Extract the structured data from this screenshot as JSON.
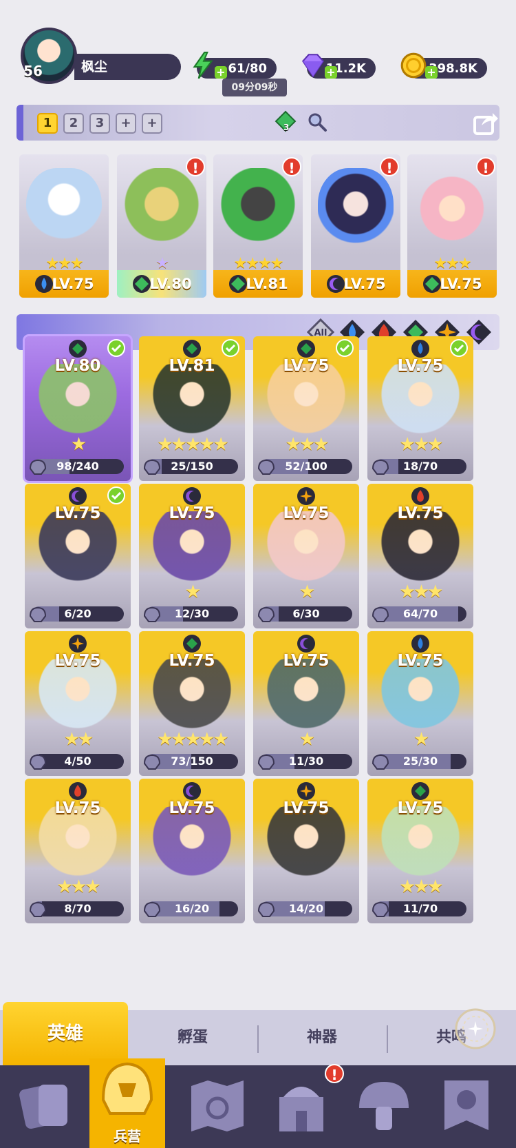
{
  "player": {
    "level": "56",
    "name": "枫尘"
  },
  "resources": {
    "energy": "61/80",
    "energy_timer": "09分09秒",
    "gems": "11.2K",
    "coins": "398.8K"
  },
  "team_tabs": [
    "1",
    "2",
    "3",
    "+",
    "+"
  ],
  "team_gem_badge": "3",
  "team": [
    {
      "level": "LV.75",
      "stars": "★★★",
      "element": "water"
    },
    {
      "level": "LV.80",
      "stars": "★",
      "element": "wind"
    },
    {
      "level": "LV.81",
      "stars": "★★★★",
      "element": "wind"
    },
    {
      "level": "LV.75",
      "stars": "",
      "element": "dark"
    },
    {
      "level": "LV.75",
      "stars": "★★★",
      "element": "wind"
    }
  ],
  "filter": {
    "all_label": "All"
  },
  "heroes": [
    {
      "level": "LV.80",
      "progress": "98/240",
      "fraction": 0.41,
      "stars": "★",
      "element": "wind",
      "checked": true,
      "theme": "purple"
    },
    {
      "level": "LV.81",
      "progress": "25/150",
      "fraction": 0.17,
      "stars": "★★★★★",
      "element": "wind",
      "checked": true,
      "theme": "gold"
    },
    {
      "level": "LV.75",
      "progress": "52/100",
      "fraction": 0.52,
      "stars": "★★★",
      "element": "wind",
      "checked": true,
      "theme": "gold"
    },
    {
      "level": "LV.75",
      "progress": "18/70",
      "fraction": 0.26,
      "stars": "★★★",
      "element": "water",
      "checked": true,
      "theme": "gold"
    },
    {
      "level": "LV.75",
      "progress": "6/20",
      "fraction": 0.3,
      "stars": "",
      "element": "dark",
      "checked": true,
      "theme": "gold"
    },
    {
      "level": "LV.75",
      "progress": "12/30",
      "fraction": 0.4,
      "stars": "★",
      "element": "dark",
      "checked": false,
      "theme": "gold"
    },
    {
      "level": "LV.75",
      "progress": "6/30",
      "fraction": 0.2,
      "stars": "★",
      "element": "light",
      "checked": false,
      "theme": "gold"
    },
    {
      "level": "LV.75",
      "progress": "64/70",
      "fraction": 0.91,
      "stars": "★★★",
      "element": "fire",
      "checked": false,
      "theme": "gold"
    },
    {
      "level": "LV.75",
      "progress": "4/50",
      "fraction": 0.08,
      "stars": "★★",
      "element": "light",
      "checked": false,
      "theme": "gold"
    },
    {
      "level": "LV.75",
      "progress": "73/150",
      "fraction": 0.49,
      "stars": "★★★★★",
      "element": "wind",
      "checked": false,
      "theme": "gold"
    },
    {
      "level": "LV.75",
      "progress": "11/30",
      "fraction": 0.37,
      "stars": "★",
      "element": "dark",
      "checked": false,
      "theme": "gold"
    },
    {
      "level": "LV.75",
      "progress": "25/30",
      "fraction": 0.83,
      "stars": "★",
      "element": "water",
      "checked": false,
      "theme": "gold"
    },
    {
      "level": "LV.75",
      "progress": "8/70",
      "fraction": 0.11,
      "stars": "★★★",
      "element": "fire",
      "checked": false,
      "theme": "gold"
    },
    {
      "level": "LV.75",
      "progress": "16/20",
      "fraction": 0.8,
      "stars": "",
      "element": "dark",
      "checked": false,
      "theme": "gold"
    },
    {
      "level": "LV.75",
      "progress": "14/20",
      "fraction": 0.7,
      "stars": "",
      "element": "light",
      "checked": false,
      "theme": "gold"
    },
    {
      "level": "LV.75",
      "progress": "11/70",
      "fraction": 0.16,
      "stars": "★★★",
      "element": "wind",
      "checked": false,
      "theme": "gold"
    }
  ],
  "subtabs": [
    "英雄",
    "孵蛋",
    "神器",
    "共鸣"
  ],
  "nav": {
    "barracks_label": "兵营"
  },
  "colors": {
    "water": "#2e7fe0",
    "fire": "#e0412b",
    "wind": "#2aa24a",
    "light": "#f2a20f",
    "dark": "#8a4fd8",
    "accent": "#f5b400"
  }
}
